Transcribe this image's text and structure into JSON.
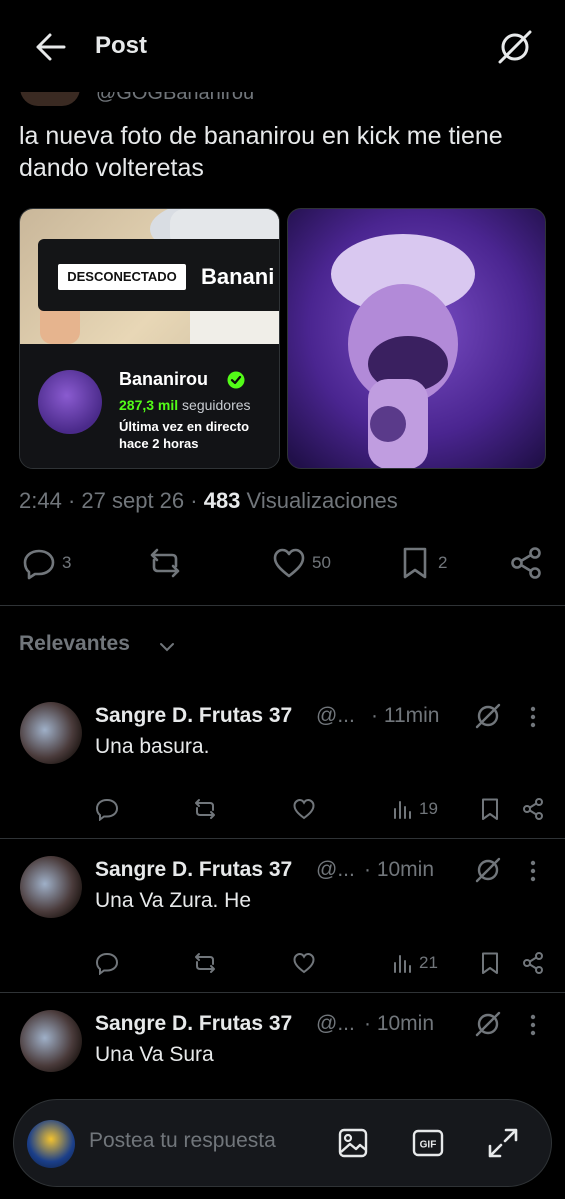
{
  "header": {
    "title": "Post",
    "back_icon": "arrow-left-icon",
    "grok_icon": "grok-icon"
  },
  "post": {
    "author_handle": "@GOGBananirou",
    "text": "la nueva foto de bananirou en kick me tiene dando volteretas",
    "media": {
      "left": {
        "badge": "DESCONECTADO",
        "banner_name": "Banani",
        "channel_name": "Bananirou",
        "followers_count": "287,3 mil",
        "followers_label": "seguidores",
        "last_live": "Última vez en directo hace 2 horas"
      }
    },
    "time": "2:44",
    "date": "27 sept 26",
    "views_count": "483",
    "views_label": "Visualizaciones",
    "actions": {
      "replies": "3",
      "reposts": "",
      "likes": "50",
      "bookmarks": "2"
    }
  },
  "sort": {
    "label": "Relevantes"
  },
  "replies": [
    {
      "name": "Sangre D. Frutas 37",
      "handle": "@...",
      "time": "· 11min",
      "text": "Una basura.",
      "views": "19"
    },
    {
      "name": "Sangre D. Frutas 37",
      "handle": "@...",
      "time": "· 10min",
      "text": "Una Va Zura. He",
      "views": "21"
    },
    {
      "name": "Sangre D. Frutas 37",
      "handle": "@...",
      "time": "· 10min",
      "text": "Una Va Sura",
      "views": ""
    }
  ],
  "compose": {
    "placeholder": "Postea tu respuesta",
    "icons": [
      "image-icon",
      "gif-icon",
      "expand-icon"
    ]
  },
  "colors": {
    "background": "#000000",
    "text": "#e7e9ea",
    "muted": "#71767b",
    "divider": "#2f3336",
    "kick_green": "#53fc18"
  }
}
